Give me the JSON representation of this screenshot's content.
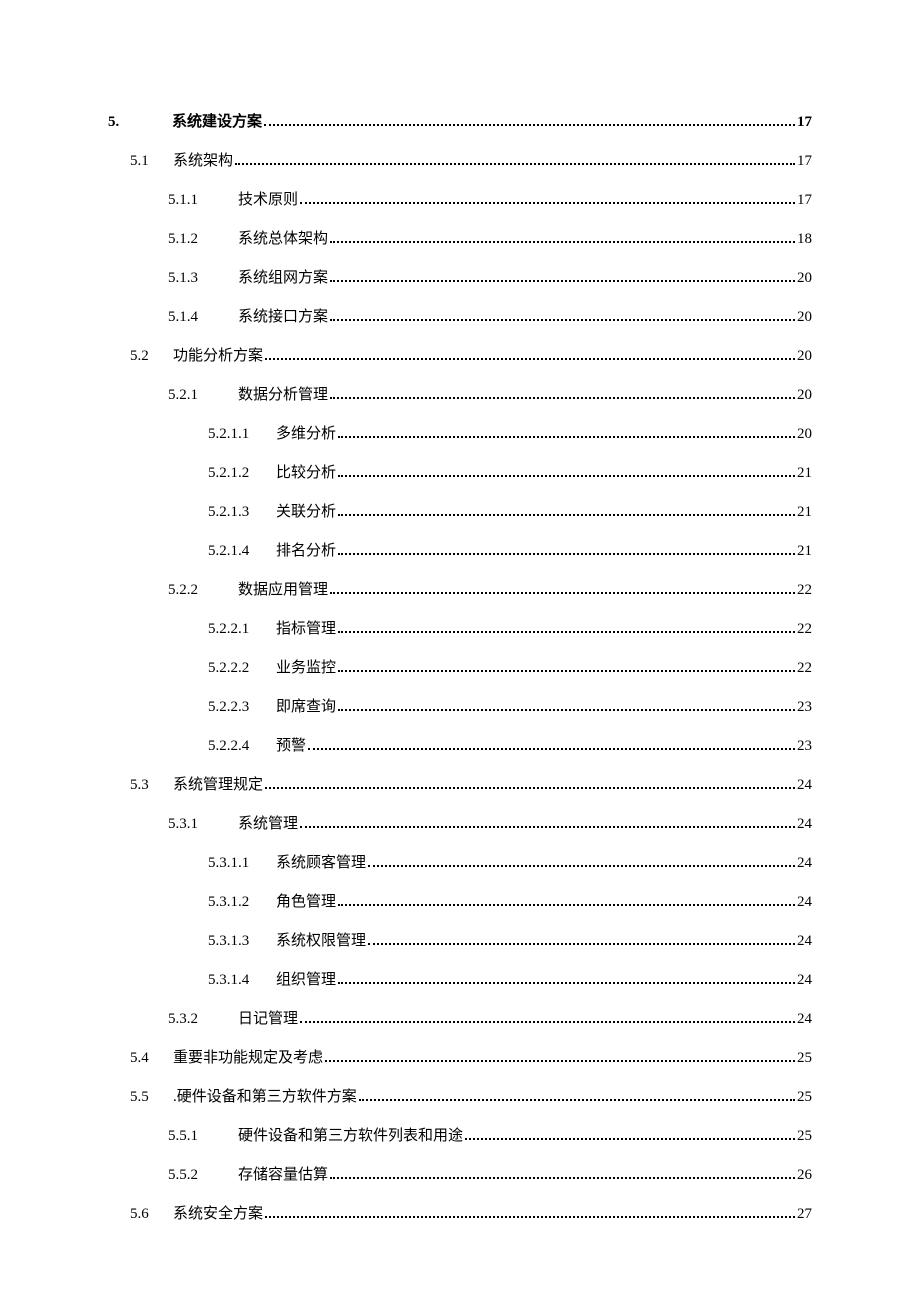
{
  "toc": [
    {
      "level": 0,
      "num": "5.",
      "title": "系统建设方案",
      "page": "17",
      "bold": true
    },
    {
      "level": 1,
      "num": "5.1",
      "title": "系统架构",
      "page": "17"
    },
    {
      "level": 2,
      "num": "5.1.1",
      "title": "技术原则",
      "page": "17"
    },
    {
      "level": 2,
      "num": "5.1.2",
      "title": "系统总体架构",
      "page": "18"
    },
    {
      "level": 2,
      "num": "5.1.3",
      "title": "系统组网方案",
      "page": "20"
    },
    {
      "level": 2,
      "num": "5.1.4",
      "title": "系统接口方案",
      "page": "20"
    },
    {
      "level": 1,
      "num": "5.2",
      "title": "功能分析方案",
      "page": "20"
    },
    {
      "level": 2,
      "num": "5.2.1",
      "title": "数据分析管理",
      "page": "20"
    },
    {
      "level": 3,
      "num": "5.2.1.1",
      "title": "多维分析",
      "page": "20"
    },
    {
      "level": 3,
      "num": "5.2.1.2",
      "title": "比较分析",
      "page": "21"
    },
    {
      "level": 3,
      "num": "5.2.1.3",
      "title": "关联分析",
      "page": "21"
    },
    {
      "level": 3,
      "num": "5.2.1.4",
      "title": "排名分析",
      "page": "21"
    },
    {
      "level": 2,
      "num": "5.2.2",
      "title": "数据应用管理",
      "page": "22"
    },
    {
      "level": 3,
      "num": "5.2.2.1",
      "title": "指标管理",
      "page": "22"
    },
    {
      "level": 3,
      "num": "5.2.2.2",
      "title": "业务监控",
      "page": "22"
    },
    {
      "level": 3,
      "num": "5.2.2.3",
      "title": "即席查询",
      "page": "23"
    },
    {
      "level": 3,
      "num": "5.2.2.4",
      "title": "预警",
      "page": "23"
    },
    {
      "level": 1,
      "num": "5.3",
      "title": "系统管理规定",
      "page": "24"
    },
    {
      "level": 2,
      "num": "5.3.1",
      "title": "系统管理",
      "page": "24"
    },
    {
      "level": 3,
      "num": "5.3.1.1",
      "title": "系统顾客管理",
      "page": "24"
    },
    {
      "level": 3,
      "num": "5.3.1.2",
      "title": "角色管理",
      "page": "24"
    },
    {
      "level": 3,
      "num": "5.3.1.3",
      "title": "系统权限管理",
      "page": "24"
    },
    {
      "level": 3,
      "num": "5.3.1.4",
      "title": "组织管理",
      "page": "24"
    },
    {
      "level": 2,
      "num": "5.3.2",
      "title": "日记管理",
      "page": "24"
    },
    {
      "level": 1,
      "num": "5.4",
      "title": "重要非功能规定及考虑",
      "page": "25"
    },
    {
      "level": 1,
      "num": "5.5",
      "title": ".硬件设备和第三方软件方案",
      "page": "25"
    },
    {
      "level": 2,
      "num": "5.5.1",
      "title": "硬件设备和第三方软件列表和用途",
      "page": "25"
    },
    {
      "level": 2,
      "num": "5.5.2",
      "title": "存储容量估算",
      "page": "26"
    },
    {
      "level": 1,
      "num": "5.6",
      "title": "系统安全方案",
      "page": "27"
    }
  ]
}
